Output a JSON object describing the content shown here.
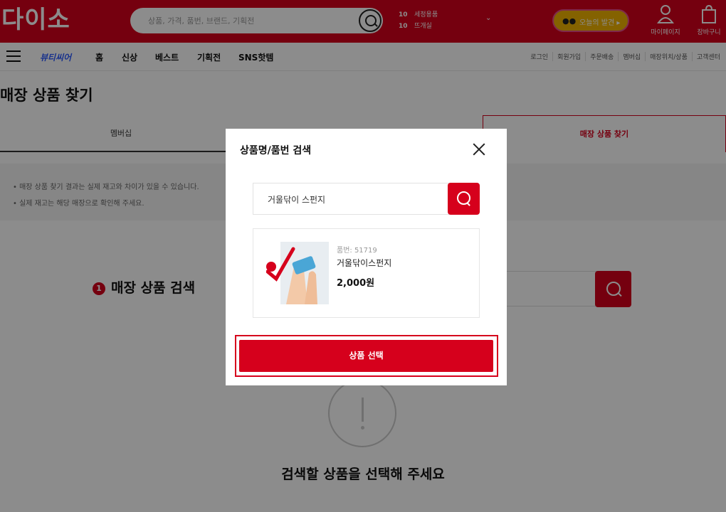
{
  "header": {
    "logo": "다이소",
    "search_placeholder": "상품, 가격, 품번, 브랜드, 기획전",
    "ranking": [
      {
        "rank": "10",
        "text": "세정용품"
      },
      {
        "rank": "10",
        "text": "뜨개실"
      }
    ],
    "today_label": "오늘의 발견 ▸",
    "today_eyes": "●●",
    "mypage_label": "마이페이지",
    "cart_label": "장바구니",
    "brand_color": "#d6001c"
  },
  "nav": {
    "items": [
      "뷰티씨어",
      "홈",
      "신상",
      "베스트",
      "기획전",
      "SNS핫템"
    ],
    "utility": [
      "로그인",
      "회원가입",
      "주문배송",
      "멤버십",
      "매장위치/상품",
      "고객센터"
    ]
  },
  "page": {
    "title": "매장 상품 찾기",
    "tabs": [
      "멤버십",
      "매장 상품 찾기"
    ],
    "notices": [
      "• 매장 상품 찾기 결과는 실제 재고와 차이가 있을 수 있습니다.",
      "• 실제 재고는 해당 매장으로 확인해 주세요."
    ],
    "step_num": "1",
    "step_title": "매장 상품 검색",
    "empty_text": "검색할 상품을 선택해 주세요"
  },
  "modal": {
    "title": "상품명/품번 검색",
    "search_value": "거울닦이 스펀지",
    "result": {
      "product_number": "품번: 51719",
      "name": "거울닦이스펀지",
      "price": "2,000원"
    },
    "select_button": "상품 선택"
  }
}
